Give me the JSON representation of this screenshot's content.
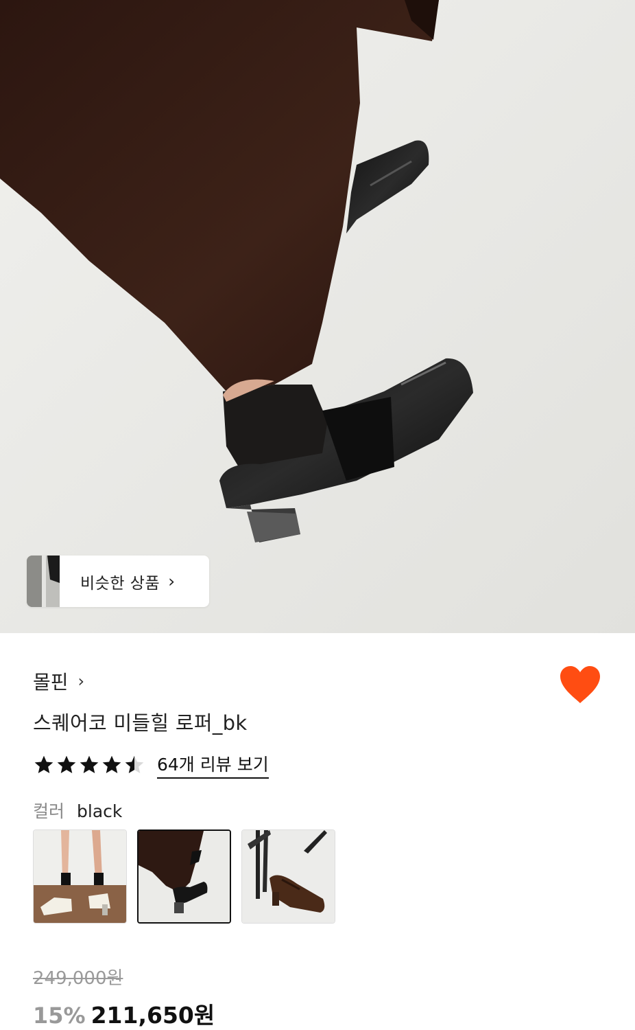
{
  "hero": {
    "similar_products_label": "비슷한 상품",
    "chevron_icon": "chevron-right-icon"
  },
  "product": {
    "brand": "몰핀",
    "title": "스퀘어코 미들힐 로퍼_bk",
    "rating": 4.5,
    "review_link": "64개 리뷰 보기",
    "wishlisted": true,
    "heart_color": "#ff4d12",
    "color_label": "컬러",
    "color_value": "black",
    "swatches": [
      {
        "name": "ivory",
        "selected": false
      },
      {
        "name": "black",
        "selected": true
      },
      {
        "name": "brown",
        "selected": false
      }
    ],
    "original_price": "249,000원",
    "discount": "15%",
    "price": "211,650원"
  }
}
